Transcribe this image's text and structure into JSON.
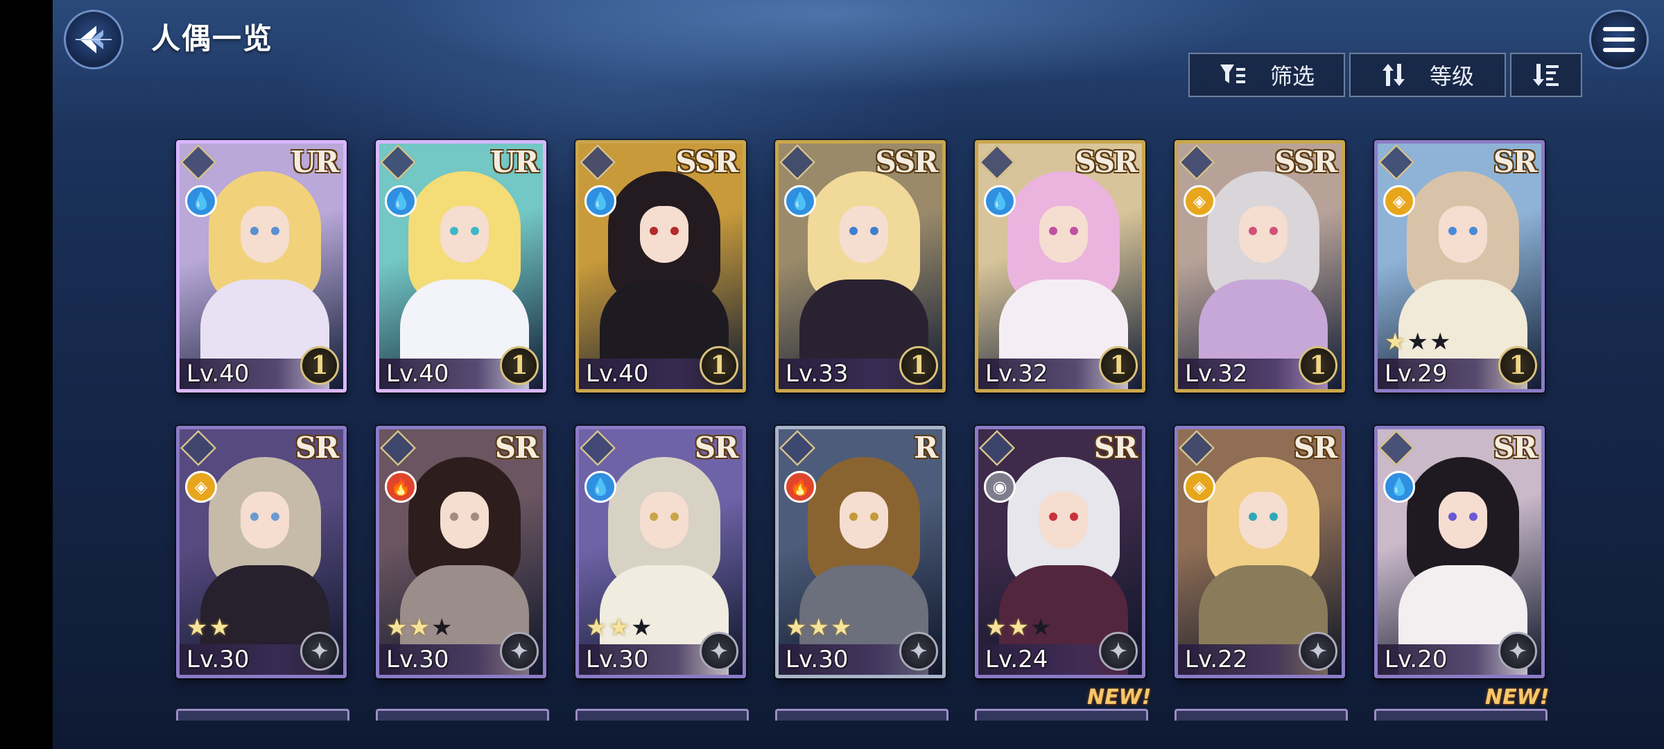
{
  "header": {
    "title": "人偶一览",
    "back_icon": "back-arrow-icon",
    "menu_icon": "hamburger-menu-icon"
  },
  "toolbar": {
    "filter_label": "筛选",
    "filter_icon": "filter-icon",
    "sort_label": "等级",
    "sort_icon": "sort-arrows-icon",
    "order_icon": "descending-order-icon"
  },
  "colors": {
    "frame_gold": "#caa64c",
    "frame_rainbow": "#d8b7ff",
    "frame_purple": "#8b7bc6",
    "frame_silver": "#a8b4c8",
    "water": "#2f8fe0",
    "fire": "#e0452c",
    "light": "#e8a61c",
    "dark": "#7d7d8c"
  },
  "cards": [
    {
      "rarity": "UR",
      "level": "Lv.40",
      "element": "water",
      "limit": "1",
      "stars": null,
      "frame": "rainbow",
      "hair": "#f1d27a",
      "outfit": "#e8e1f4",
      "bg": "#b9a8d8",
      "eye": "#5a8fd0"
    },
    {
      "rarity": "UR",
      "level": "Lv.40",
      "element": "water",
      "limit": "1",
      "stars": null,
      "frame": "rainbow",
      "hair": "#f4dc76",
      "outfit": "#f2f4fa",
      "bg": "#73c7c4",
      "eye": "#3fb6c9"
    },
    {
      "rarity": "SSR",
      "level": "Lv.40",
      "element": "water",
      "limit": "1",
      "stars": null,
      "frame": "gold",
      "hair": "#231b1f",
      "outfit": "#1d1b21",
      "bg": "#c89a3a",
      "eye": "#b32a2a"
    },
    {
      "rarity": "SSR",
      "level": "Lv.33",
      "element": "water",
      "limit": "1",
      "stars": null,
      "frame": "gold",
      "hair": "#f1d99a",
      "outfit": "#2a2231",
      "bg": "#9a8a6a",
      "eye": "#3f7fd1"
    },
    {
      "rarity": "SSR",
      "level": "Lv.32",
      "element": "water",
      "limit": "1",
      "stars": null,
      "frame": "gold",
      "hair": "#eab4de",
      "outfit": "#f4eef4",
      "bg": "#d8c49a",
      "eye": "#c050a0"
    },
    {
      "rarity": "SSR",
      "level": "Lv.32",
      "element": "light",
      "limit": "1",
      "stars": null,
      "frame": "gold",
      "hair": "#d9d5d8",
      "outfit": "#c7a7d7",
      "bg": "#b8a298",
      "eye": "#d2507a"
    },
    {
      "rarity": "SR",
      "level": "Lv.29",
      "element": "light",
      "limit": "1",
      "stars": {
        "on": 1,
        "total": 3
      },
      "frame": "purple",
      "hair": "#d8c3a8",
      "outfit": "#f1ead8",
      "bg": "#8fb3d6",
      "eye": "#4a8ad8"
    },
    {
      "rarity": "SR",
      "level": "Lv.30",
      "element": "light",
      "limit": "wing",
      "stars": {
        "on": 2,
        "total": 2
      },
      "frame": "purple",
      "hair": "#c5bba8",
      "outfit": "#27212e",
      "bg": "#574a80",
      "eye": "#6a9ad0"
    },
    {
      "rarity": "SR",
      "level": "Lv.30",
      "element": "fire",
      "limit": "wing",
      "stars": {
        "on": 2,
        "total": 3
      },
      "frame": "purple",
      "hair": "#2d1e1d",
      "outfit": "#9b8d8a",
      "bg": "#6a5560",
      "eye": "#a58a80"
    },
    {
      "rarity": "SR",
      "level": "Lv.30",
      "element": "water",
      "limit": "wing",
      "stars": {
        "on": 2,
        "total": 3
      },
      "frame": "purple",
      "hair": "#d8d2c4",
      "outfit": "#f0ecdf",
      "bg": "#6f63a8",
      "eye": "#c9a44a"
    },
    {
      "rarity": "R",
      "level": "Lv.30",
      "element": "fire",
      "limit": "wing",
      "stars": {
        "on": 3,
        "total": 3
      },
      "frame": "silver",
      "hair": "#8a6430",
      "outfit": "#6c6f7c",
      "bg": "#4d5c7a",
      "eye": "#c29a3a"
    },
    {
      "rarity": "SR",
      "level": "Lv.24",
      "element": "dark",
      "limit": "wing",
      "stars": {
        "on": 2,
        "total": 3
      },
      "frame": "purple",
      "hair": "#e6e6ec",
      "outfit": "#52263e",
      "bg": "#3e2a4a",
      "eye": "#c8323c"
    },
    {
      "rarity": "SR",
      "level": "Lv.22",
      "element": "light",
      "limit": "wing",
      "stars": null,
      "frame": "purple",
      "hair": "#f1cf86",
      "outfit": "#8a7b5a",
      "bg": "#8f6e55",
      "eye": "#2fa9b8"
    },
    {
      "rarity": "SR",
      "level": "Lv.20",
      "element": "water",
      "limit": "wing",
      "stars": null,
      "frame": "purple",
      "hair": "#1f1a22",
      "outfit": "#f3eef0",
      "bg": "#c9b9c9",
      "eye": "#6a5ad6"
    }
  ],
  "new_labels": [
    "NEW!",
    "NEW!"
  ]
}
